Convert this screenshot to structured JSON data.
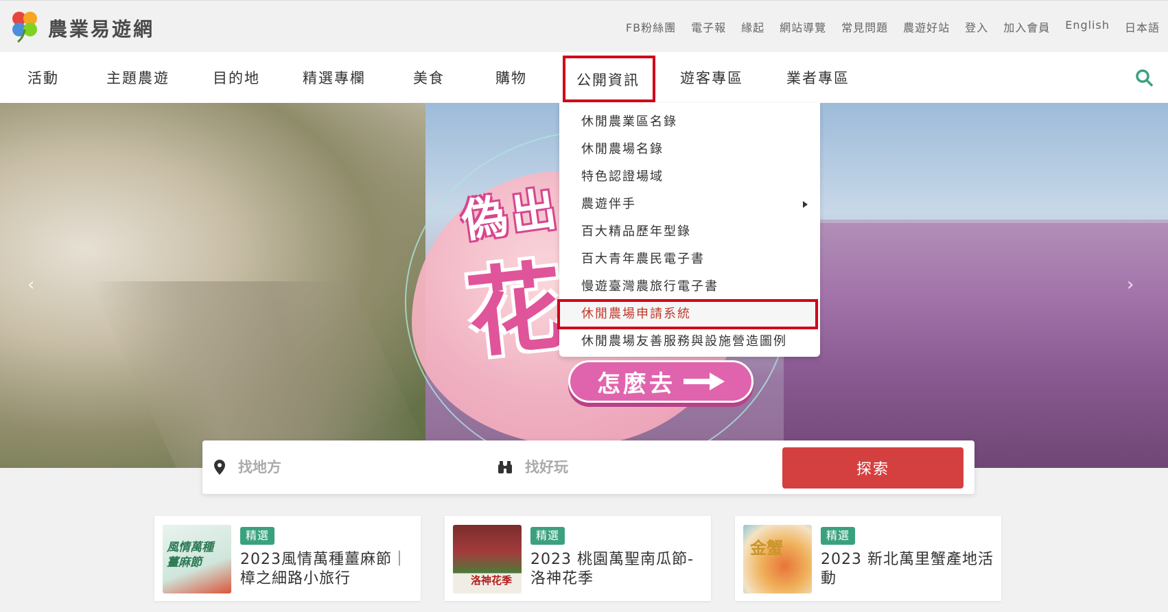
{
  "header": {
    "site_name": "農業易遊網",
    "util_links": [
      "FB粉絲團",
      "電子報",
      "緣起",
      "網站導覽",
      "常見問題",
      "農遊好站",
      "登入",
      "加入會員",
      "English",
      "日本語"
    ]
  },
  "nav": {
    "items": [
      "活動",
      "主題農遊",
      "目的地",
      "精選專欄",
      "美食",
      "購物",
      "公開資訊",
      "遊客專區",
      "業者專區"
    ],
    "active": "公開資訊"
  },
  "dropdown": {
    "items": [
      "休閒農業區名錄",
      "休閒農場名錄",
      "特色認證場域",
      "農遊伴手",
      "百大精品歷年型錄",
      "百大青年農民電子書",
      "慢遊臺灣農旅行電子書",
      "休閒農場申請系統",
      "休閒農場友善服務與設施營造圖例"
    ],
    "highlighted": "休閒農場申請系統",
    "has_submenu": "農遊伴手"
  },
  "hero": {
    "title_line1": "偽出",
    "title_line2": "花",
    "cta_label": "怎麼去"
  },
  "search": {
    "place_placeholder": "找地方",
    "fun_placeholder": "找好玩",
    "button_label": "探索"
  },
  "cards": [
    {
      "badge": "精選",
      "title": "2023風情萬種薑麻節｜樟之細路小旅行",
      "thumb_text": "風情萬種 薑麻節"
    },
    {
      "badge": "精選",
      "title": "2023 桃園萬聖南瓜節-洛神花季",
      "thumb_text": "洛神花季"
    },
    {
      "badge": "精選",
      "title": "2023 新北萬里蟹產地活動",
      "thumb_text": "金蟹"
    }
  ],
  "colors": {
    "accent_red": "#d4403f",
    "highlight_border": "#d0021b",
    "badge_green": "#3aa17e",
    "hero_pink": "#e064ad"
  }
}
